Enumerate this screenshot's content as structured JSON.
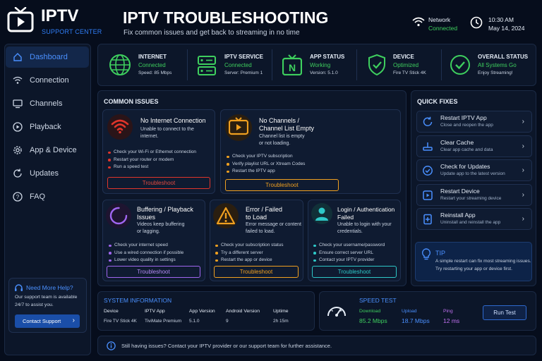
{
  "brand": {
    "name": "IPTV",
    "sub": "SUPPORT CENTER"
  },
  "header": {
    "title": "IPTV TROUBLESHOOTING",
    "subtitle": "Fix common issues and get back to streaming in no time"
  },
  "network": {
    "label": "Network",
    "status": "Connected"
  },
  "clock": {
    "time": "10:30 AM",
    "date": "May 14, 2024"
  },
  "nav": [
    "Dashboard",
    "Connection",
    "Channels",
    "Playback",
    "App & Device",
    "Updates",
    "FAQ"
  ],
  "help": {
    "title": "Need More Help?",
    "text1": "Our support team is available",
    "text2": "24/7 to assist you.",
    "button": "Contact Support"
  },
  "status": [
    {
      "label": "INTERNET",
      "v1": "Connected",
      "v2": "Speed: 85 Mbps"
    },
    {
      "label": "IPTV SERVICE",
      "v1": "Connected",
      "v2": "Server: Premium 1"
    },
    {
      "label": "APP STATUS",
      "v1": "Working",
      "v2": "Version: 5.1.0"
    },
    {
      "label": "DEVICE",
      "v1": "Optimized",
      "v2": "Fire TV Stick 4K"
    },
    {
      "label": "OVERALL STATUS",
      "v1": "All Systems Go",
      "v2": "Enjoy Streaming!"
    }
  ],
  "issues_title": "COMMON ISSUES",
  "issues": [
    {
      "title1": "No Internet Connection",
      "title2": "",
      "desc1": "Unable to connect to the",
      "desc2": "internet.",
      "bullets": [
        "Check your Wi-Fi or Ethernet connection",
        "Restart your router or modem",
        "Run a speed test"
      ],
      "button": "Troubleshoot"
    },
    {
      "title1": "No Channels /",
      "title2": "Channel List Empty",
      "desc1": "Channel list is empty",
      "desc2": "or not loading.",
      "bullets": [
        "Check your IPTV subscription",
        "Verify playlist URL or Xtream Codes",
        "Restart the IPTV app"
      ],
      "button": "Troubleshoot"
    },
    {
      "title1": "Buffering / Playback",
      "title2": "Issues",
      "desc1": "Videos keep buffering",
      "desc2": "or lagging.",
      "bullets": [
        "Check your internet speed",
        "Use a wired connection if possible",
        "Lower video quality in settings"
      ],
      "button": "Troubleshoot"
    },
    {
      "title1": "Error / Failed",
      "title2": "to Load",
      "desc1": "Error message or content",
      "desc2": "failed to load.",
      "bullets": [
        "Check your subscription status",
        "Try a different server",
        "Restart the app or device"
      ],
      "button": "Troubleshoot"
    },
    {
      "title1": "Login / Authentication",
      "title2": "Failed",
      "desc1": "Unable to login with your",
      "desc2": "credentials.",
      "bullets": [
        "Check your username/password",
        "Ensure correct server URL",
        "Contact your IPTV provider"
      ],
      "button": "Troubleshoot"
    }
  ],
  "quick_title": "QUICK FIXES",
  "quick": [
    {
      "title": "Restart IPTV App",
      "sub": "Close and reopen the app"
    },
    {
      "title": "Clear Cache",
      "sub": "Clear app cache and data"
    },
    {
      "title": "Check for Updates",
      "sub": "Update app to the latest version"
    },
    {
      "title": "Restart Device",
      "sub": "Restart your streaming device"
    },
    {
      "title": "Reinstall App",
      "sub": "Uninstall and reinstall the app"
    }
  ],
  "tip": {
    "title": "TIP",
    "line1": "A simple restart can fix most streaming issues.",
    "line2": "Try restarting your app or device first."
  },
  "sysinfo": {
    "title": "SYSTEM INFORMATION",
    "cols": [
      {
        "label": "Device",
        "value": "Fire TV Stick 4K"
      },
      {
        "label": "IPTV App",
        "value": "TiviMate Premium"
      },
      {
        "label": "App Version",
        "value": "5.1.0"
      },
      {
        "label": "Android Version",
        "value": "9"
      },
      {
        "label": "Uptime",
        "value": "2h 15m"
      }
    ]
  },
  "speed": {
    "title": "SPEED TEST",
    "download_label": "Download",
    "download": "85.2 Mbps",
    "upload_label": "Upload",
    "upload": "18.7 Mbps",
    "ping_label": "Ping",
    "ping": "12 ms",
    "button": "Run Test"
  },
  "footer": "Still having issues? Contact your IPTV provider or our support team for further assistance.",
  "colors": {
    "green": "#3ecf5e",
    "blue": "#2f7df6",
    "red": "#e0352b",
    "orange": "#f0a020",
    "purple": "#a066f0",
    "teal": "#2ec8c8"
  }
}
